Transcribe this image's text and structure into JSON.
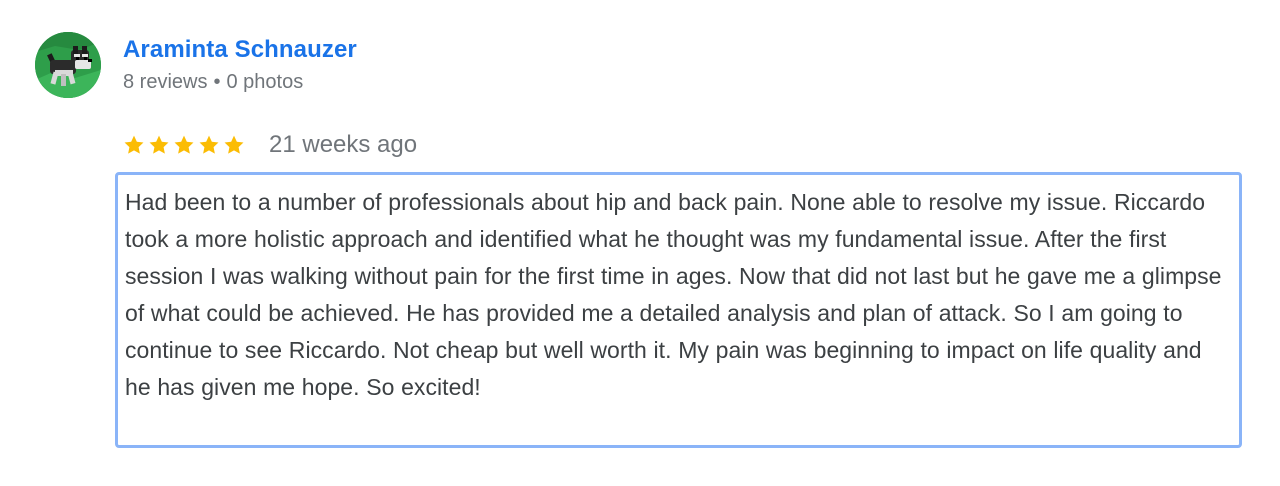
{
  "review": {
    "author": {
      "name": "Araminta Schnauzer",
      "reviews_count": "8 reviews",
      "separator": "•",
      "photos_count": "0 photos",
      "avatar_icon": "schnauzer-dog-avatar-icon"
    },
    "rating": {
      "stars": 5,
      "max_stars": 5,
      "star_icon": "star-icon",
      "star_color": "#fbbc04"
    },
    "time": "21 weeks ago",
    "text": "Had been to a number of professionals about hip and back pain. None able to resolve my issue. Riccardo took a more holistic approach and identified what he thought was my fundamental issue. After the first session I was walking without pain for the first time in ages. Now that did not last but he gave me a glimpse of what could be achieved. He has provided me a detailed analysis and plan of attack. So I am going to continue to see Riccardo. Not cheap but well worth it. My pain was beginning to impact on life quality and he has given me hope. So excited!"
  },
  "colors": {
    "link": "#1a73e8",
    "secondary_text": "#70757a",
    "body_text": "#3c4043",
    "focus_border": "#8ab4f8",
    "avatar_bg": "#2e9e4a"
  }
}
